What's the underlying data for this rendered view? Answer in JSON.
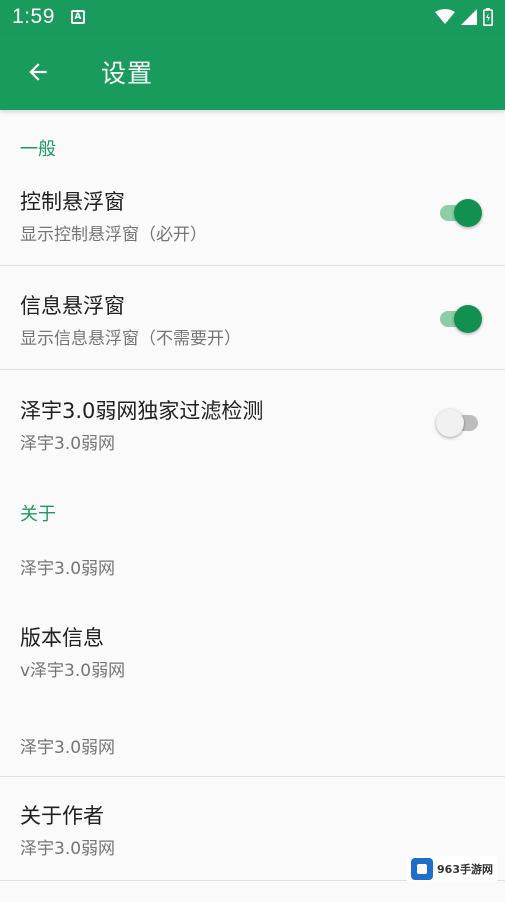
{
  "status_bar": {
    "time": "1:59",
    "app_icon": "A"
  },
  "app_bar": {
    "title": "设置"
  },
  "sections": {
    "general": {
      "header": "一般"
    },
    "about": {
      "header": "关于"
    }
  },
  "items": {
    "control_float": {
      "title": "控制悬浮窗",
      "subtitle": "显示控制悬浮窗（必开）",
      "enabled": true
    },
    "info_float": {
      "title": "信息悬浮窗",
      "subtitle": "显示信息悬浮窗（不需要开）",
      "enabled": true
    },
    "filter_detect": {
      "title": "泽宇3.0弱网独家过滤检测",
      "subtitle": "泽宇3.0弱网",
      "enabled": false
    },
    "about_text": {
      "subtitle": "泽宇3.0弱网"
    },
    "version": {
      "title": "版本信息",
      "subtitle": "v泽宇3.0弱网"
    },
    "about_text2": {
      "subtitle": "泽宇3.0弱网"
    },
    "author": {
      "title": "关于作者",
      "subtitle": "泽宇3.0弱网"
    }
  },
  "watermark": {
    "text": "963手游网"
  },
  "colors": {
    "primary": "#1a9b5e",
    "switch_on_thumb": "#12904f",
    "switch_on_track": "#8ccfa6"
  }
}
